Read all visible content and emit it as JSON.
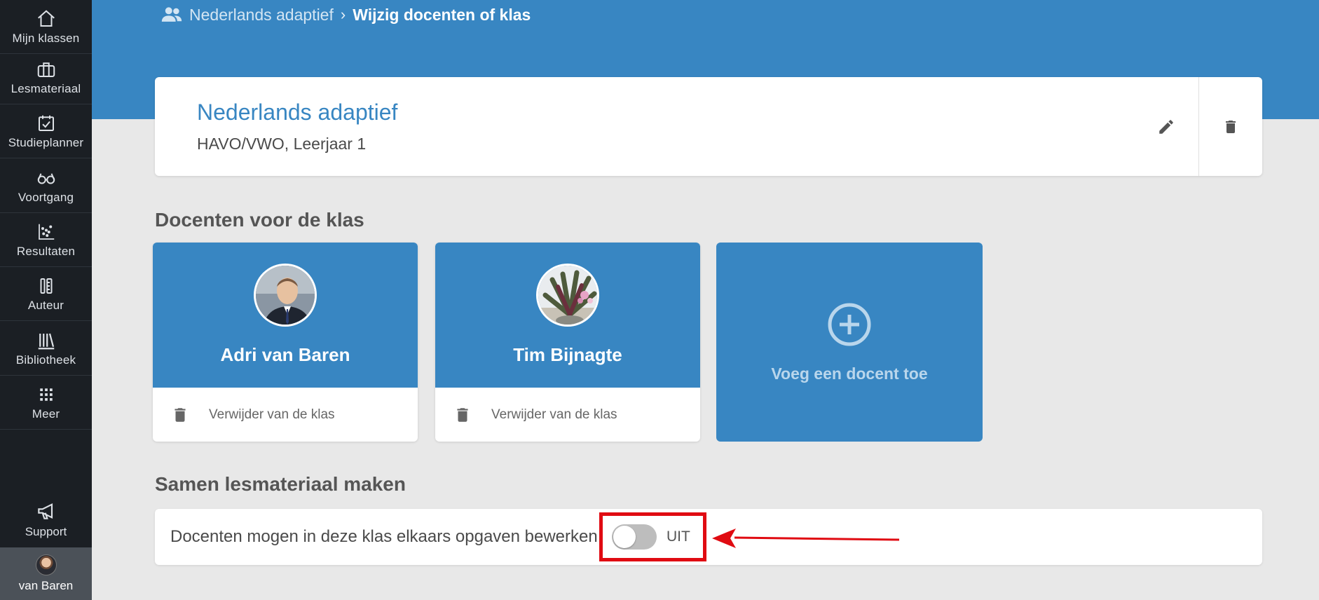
{
  "sidebar": {
    "items": [
      {
        "label": "Mijn klassen",
        "icon": "home-icon"
      },
      {
        "label": "Lesmateriaal",
        "icon": "briefcase-icon"
      },
      {
        "label": "Studieplanner",
        "icon": "calendar-check-icon"
      },
      {
        "label": "Voortgang",
        "icon": "glasses-icon"
      },
      {
        "label": "Resultaten",
        "icon": "scatter-chart-icon"
      },
      {
        "label": "Auteur",
        "icon": "author-icon"
      },
      {
        "label": "Bibliotheek",
        "icon": "library-icon"
      },
      {
        "label": "Meer",
        "icon": "grid-icon"
      }
    ],
    "support": {
      "label": "Support",
      "icon": "megaphone-icon"
    },
    "user": {
      "label": "van Baren"
    }
  },
  "breadcrumb": {
    "parent": "Nederlands adaptief",
    "current": "Wijzig docenten of klas",
    "icon": "people-icon"
  },
  "class_card": {
    "title": "Nederlands adaptief",
    "subtitle": "HAVO/VWO, Leerjaar 1",
    "edit_icon": "pencil-icon",
    "delete_icon": "trash-icon"
  },
  "teachers_section": {
    "title": "Docenten voor de klas",
    "teachers": [
      {
        "name": "Adri van Baren",
        "remove_label": "Verwijder van de klas"
      },
      {
        "name": "Tim Bijnagte",
        "remove_label": "Verwijder van de klas"
      }
    ],
    "add_label": "Voeg een docent toe"
  },
  "collab_section": {
    "title": "Samen lesmateriaal maken",
    "setting_label": "Docenten mogen in deze klas elkaars opgaven bewerken",
    "toggle_state": "UIT",
    "toggle_on": false
  },
  "colors": {
    "primary": "#3886c2",
    "sidebar": "#1b1f24",
    "annotation": "#e00b12"
  }
}
